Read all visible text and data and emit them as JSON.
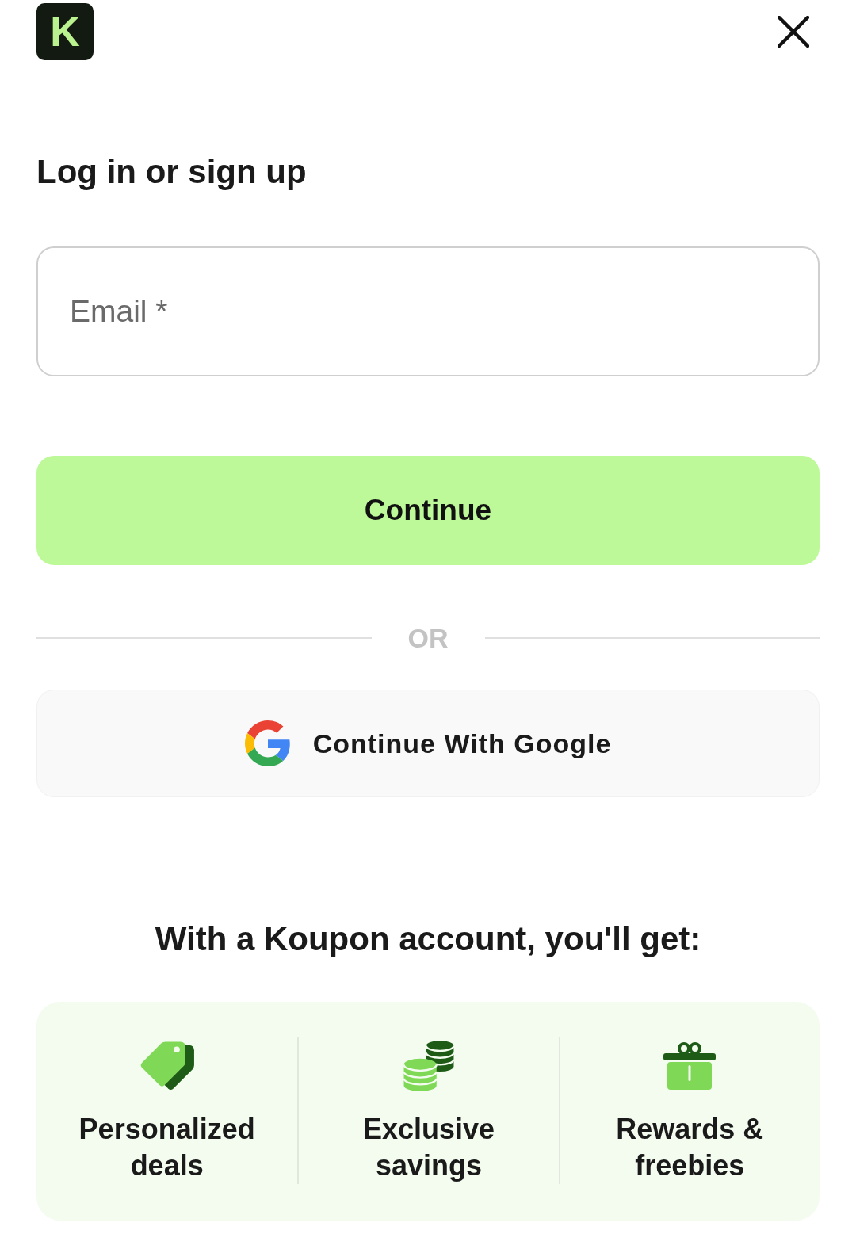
{
  "header": {
    "logo": {
      "letter": "K"
    }
  },
  "title": "Log in or sign up",
  "email_field": {
    "placeholder": "Email *"
  },
  "continue_button": {
    "label": "Continue"
  },
  "divider": {
    "label": "OR"
  },
  "google_button": {
    "label": "Continue With Google"
  },
  "benefits": {
    "heading": "With a Koupon account, you'll get:",
    "items": [
      {
        "kind": "tag",
        "label": "Personalized deals"
      },
      {
        "kind": "coins",
        "label": "Exclusive savings"
      },
      {
        "kind": "gift",
        "label": "Rewards & freebies"
      }
    ]
  }
}
